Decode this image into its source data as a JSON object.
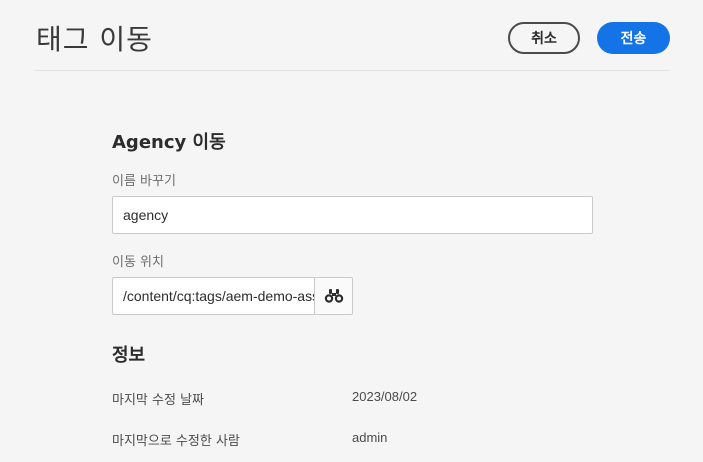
{
  "header": {
    "title": "태그 이동",
    "cancel_label": "취소",
    "submit_label": "전송"
  },
  "form": {
    "section_title": "Agency 이동",
    "rename_label": "이름 바꾸기",
    "rename_value": "agency",
    "move_to_label": "이동 위치",
    "move_to_value": "/content/cq:tags/aem-demo-assets",
    "browse_icon": "binoculars-icon"
  },
  "info": {
    "title": "정보",
    "rows": [
      {
        "key": "마지막 수정 날짜",
        "value": "2023/08/02"
      },
      {
        "key": "마지막으로 수정한 사람",
        "value": "admin"
      }
    ]
  },
  "colors": {
    "accent": "#1473e6",
    "background": "#f5f5f5"
  }
}
